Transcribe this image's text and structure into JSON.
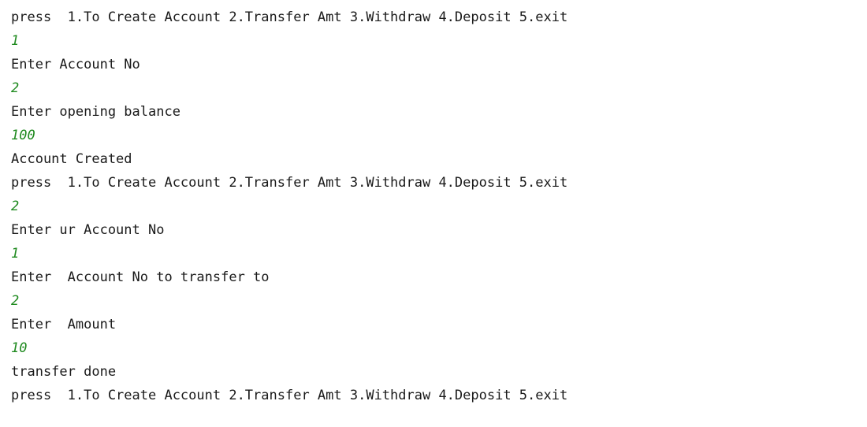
{
  "console": {
    "lines": [
      {
        "type": "output",
        "text": "press  1.To Create Account 2.Transfer Amt 3.Withdraw 4.Deposit 5.exit"
      },
      {
        "type": "input",
        "text": "1"
      },
      {
        "type": "output",
        "text": "Enter Account No"
      },
      {
        "type": "input",
        "text": "2"
      },
      {
        "type": "output",
        "text": "Enter opening balance"
      },
      {
        "type": "input",
        "text": "100"
      },
      {
        "type": "output",
        "text": "Account Created"
      },
      {
        "type": "output",
        "text": "press  1.To Create Account 2.Transfer Amt 3.Withdraw 4.Deposit 5.exit"
      },
      {
        "type": "input",
        "text": "2"
      },
      {
        "type": "output",
        "text": "Enter ur Account No"
      },
      {
        "type": "input",
        "text": "1"
      },
      {
        "type": "output",
        "text": "Enter  Account No to transfer to"
      },
      {
        "type": "input",
        "text": "2"
      },
      {
        "type": "output",
        "text": "Enter  Amount"
      },
      {
        "type": "input",
        "text": "10"
      },
      {
        "type": "output",
        "text": "transfer done"
      },
      {
        "type": "output",
        "text": "press  1.To Create Account 2.Transfer Amt 3.Withdraw 4.Deposit 5.exit"
      }
    ],
    "colors": {
      "output": "#1a1a1a",
      "input": "#1f8a1f",
      "background": "#ffffff"
    }
  }
}
